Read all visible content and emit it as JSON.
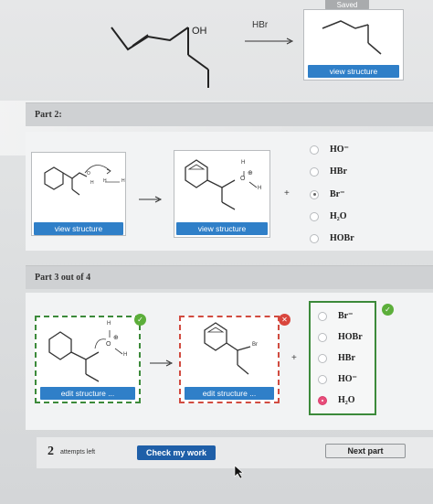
{
  "header": {
    "saved_label": "Saved"
  },
  "part1": {
    "oh_label": "OH",
    "reagent": "HBr",
    "view_structure_label": "view structure"
  },
  "part2": {
    "title": "Part 2:",
    "view_structure_left": "view structure",
    "view_structure_right": "view structure",
    "plus": "+",
    "mol_labels": {
      "o1": "O",
      "h1": "H",
      "h2": "H",
      "h3": "H",
      "plus_charge": "⊕",
      "o2": "O",
      "h4": "H",
      "h5": "H"
    },
    "options": [
      {
        "label": "HO⁻",
        "selected": false
      },
      {
        "label": "HBr",
        "selected": false
      },
      {
        "label": "Br⁻",
        "selected": true
      },
      {
        "label": "H₂O",
        "selected": false
      },
      {
        "label": "HOBr",
        "selected": false
      }
    ]
  },
  "part3": {
    "title": "Part 3 out of 4",
    "edit_structure_left": "edit structure ...",
    "edit_structure_right": "edit structure ...",
    "plus": "+",
    "mol_labels": {
      "h1": "H",
      "o": "O",
      "charge": "⊕",
      "h2": "H",
      "br": "Br"
    },
    "options": [
      {
        "label": "Br⁻",
        "selected": false
      },
      {
        "label": "HOBr",
        "selected": false
      },
      {
        "label": "HBr",
        "selected": false
      },
      {
        "label": "HO⁻",
        "selected": false
      },
      {
        "label": "H₂O",
        "selected": true
      }
    ],
    "left_status": "correct",
    "right_status": "incorrect",
    "options_status": "correct"
  },
  "footer": {
    "attempts_count": "2",
    "attempts_label": "attempts left",
    "check_label": "Check my work",
    "next_label": "Next part"
  },
  "colors": {
    "accent_blue": "#2f7fc8",
    "correct_green": "#5cae3a",
    "incorrect_red": "#d9463d",
    "selected_pink": "#e84d7a"
  }
}
